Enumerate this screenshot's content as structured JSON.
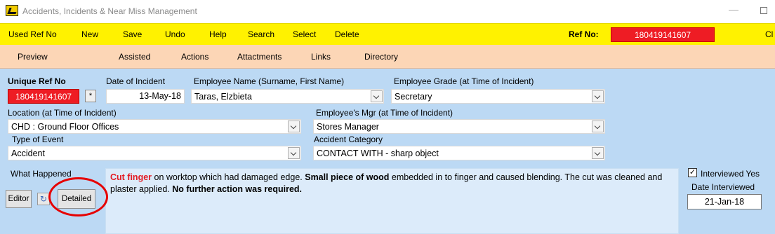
{
  "window": {
    "title": "Accidents, Incidents & Near Miss Management"
  },
  "toolbar": {
    "items": [
      "Used Ref No",
      "New",
      "Save",
      "Undo",
      "Help",
      "Search",
      "Select",
      "Delete"
    ],
    "ref_label": "Ref No:",
    "ref_value": "180419141607",
    "close_clip": "Cl"
  },
  "menu": {
    "items": [
      "Preview",
      "Assisted",
      "Actions",
      "Attactments",
      "Links",
      "Directory"
    ]
  },
  "form": {
    "unique_ref": {
      "label": "Unique Ref No",
      "value": "180419141607",
      "star": "*"
    },
    "date_of_incident": {
      "label": "Date of Incident",
      "value": "13-May-18"
    },
    "employee_name": {
      "label": "Employee Name (Surname, First Name)",
      "value": "Taras, Elzbieta"
    },
    "employee_grade": {
      "label": "Employee Grade (at Time of Incident)",
      "value": "Secretary"
    },
    "location": {
      "label": "Location (at Time of Incident)",
      "value": "CHD : Ground Floor Offices"
    },
    "employees_mgr": {
      "label": "Employee's Mgr (at Time of Incident)",
      "value": "Stores Manager"
    },
    "type_of_event": {
      "label": "Type of Event",
      "value": "Accident"
    },
    "accident_category": {
      "label": "Accident Category",
      "value": "CONTACT WITH - sharp object"
    },
    "what_happened": {
      "label": "What Happened",
      "seg1": "Cut finger",
      "seg2": " on  worktop which had damaged edge.  ",
      "seg3": "Small piece of wood",
      "seg4": " embedded in to finger and caused blending.  The cut was cleaned and plaster applied.  ",
      "seg5": "No further action was required."
    },
    "buttons": {
      "editor": "Editor",
      "detailed": "Detailed"
    },
    "interviewed": {
      "label": "Interviewed Yes",
      "checked": true,
      "check_glyph": "✓",
      "date_label": "Date Interviewed",
      "date_value": "21-Jan-18"
    }
  },
  "colors": {
    "toolbar": "#fff200",
    "menu": "#fcd6b6",
    "form_bg": "#bcd9f4",
    "ref_red": "#ee1c24",
    "highlight_ring": "#e60000"
  }
}
